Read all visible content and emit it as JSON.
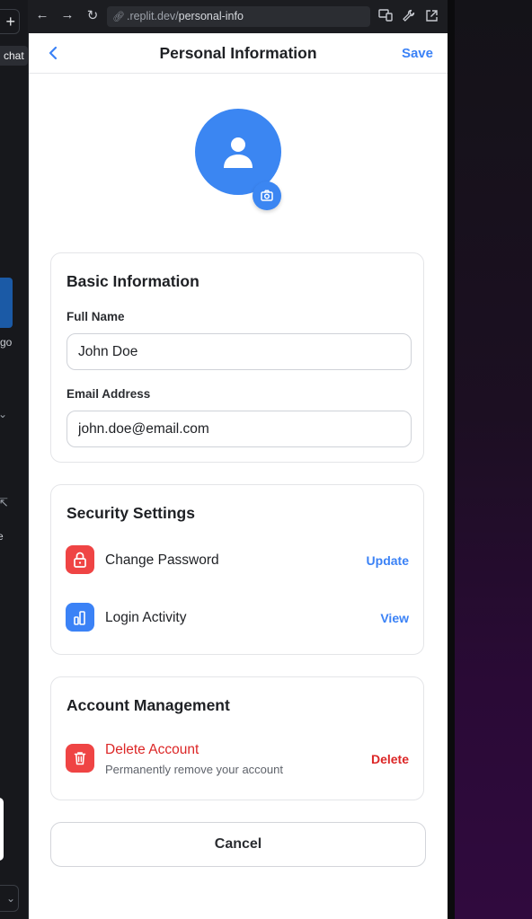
{
  "browser": {
    "url_domain": ".replit.dev/",
    "url_path": "personal-info"
  },
  "sidebar_strip": {
    "tooltip": "chat",
    "truncated_text_1": "go",
    "truncated_text_2": "e"
  },
  "header": {
    "title": "Personal Information",
    "save_label": "Save"
  },
  "basic_info": {
    "title": "Basic Information",
    "full_name_label": "Full Name",
    "full_name_value": "John Doe",
    "email_label": "Email Address",
    "email_value": "john.doe@email.com"
  },
  "security": {
    "title": "Security Settings",
    "rows": [
      {
        "label": "Change Password",
        "action": "Update",
        "icon": "lock-icon",
        "color": "#ef4444"
      },
      {
        "label": "Login Activity",
        "action": "View",
        "icon": "activity-chart-icon",
        "color": "#3b82f6"
      }
    ]
  },
  "account": {
    "title": "Account Management",
    "delete_label": "Delete Account",
    "delete_desc": "Permanently remove your account",
    "delete_action": "Delete",
    "icon": "trash-icon"
  },
  "cancel_label": "Cancel",
  "colors": {
    "accent": "#3b82f6",
    "danger": "#dc2626",
    "danger_icon_bg": "#ef4444"
  }
}
